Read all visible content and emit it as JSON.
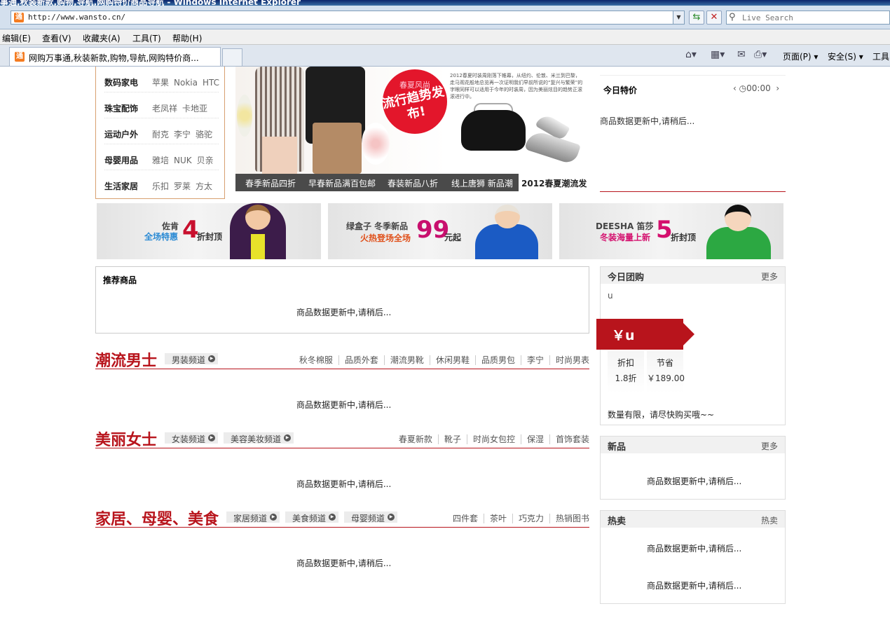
{
  "browser": {
    "window_title": "事通,秋装新款,购物,导航,网购特价商品导航 - Windows Internet Explorer",
    "url": "http://www.wansto.cn/",
    "favicon": "通",
    "search_placeholder": "Live Search",
    "menu": [
      "编辑(E)",
      "查看(V)",
      "收藏夹(A)",
      "工具(T)",
      "帮助(H)"
    ],
    "tab_title": "网购万事通,秋装新款,购物,导航,网购特价商...",
    "commands": {
      "page": "页面(P)",
      "safety": "安全(S)",
      "tools": "工具"
    }
  },
  "categories": [
    {
      "name": "数码家电",
      "links": [
        "苹果",
        "Nokia",
        "HTC"
      ]
    },
    {
      "name": "珠宝配饰",
      "links": [
        "老凤祥",
        "卡地亚"
      ]
    },
    {
      "name": "运动户外",
      "links": [
        "耐克",
        "李宁",
        "骆驼"
      ]
    },
    {
      "name": "母婴用品",
      "links": [
        "雅培",
        "NUK",
        "贝亲"
      ]
    },
    {
      "name": "生活家居",
      "links": [
        "乐扣",
        "罗莱",
        "方太"
      ]
    }
  ],
  "banner": {
    "circle_sub": "春夏风尚",
    "circle_main": "流行趋势发布!",
    "blurb": "2012春夏时装周刚落下帷幕，从纽约、伦敦、米兰到巴黎，走马观花般地总览再一次证明我们早前所说的“复兴与繁荣”的字眼同样可以适用于今年的时装周，因为美丽炫目的趋势正滚滚进行中。",
    "tabs": [
      "春季新品四折",
      "早春新品满百包邮",
      "春装新品八折",
      "线上唐狮 新品潮"
    ],
    "active_tab": "2012春夏潮流发"
  },
  "today_special": {
    "title": "今日特价",
    "timer": "00:00",
    "message": "商品数据更新中,请稍后..."
  },
  "promos": [
    {
      "brand": "佐肯",
      "sub": "全场特惠",
      "num": "4",
      "tail": "折封顶",
      "sub_color": "#2a8ad4",
      "num_color": "#c8102e"
    },
    {
      "brand": "绿盒子 冬季新品",
      "sub": "火热登场全场",
      "num": "99",
      "tail": "元起",
      "sub_color": "#e0501a",
      "num_color": "#c8106e"
    },
    {
      "brand": "DEESHA 笛莎",
      "sub": "冬装海量上新",
      "num": "5",
      "tail": "折封顶",
      "sub_color": "#d4106e",
      "num_color": "#d4106e"
    }
  ],
  "recommend": {
    "title": "推荐商品",
    "message": "商品数据更新中,请稍后..."
  },
  "sections": [
    {
      "title": "潮流男士",
      "channels": [
        "男装频道"
      ],
      "links": [
        "秋冬棉服",
        "品质外套",
        "潮流男靴",
        "休闲男鞋",
        "品质男包",
        "李宁",
        "时尚男表"
      ],
      "message": "商品数据更新中,请稍后..."
    },
    {
      "title": "美丽女士",
      "channels": [
        "女装频道",
        "美容美妆频道"
      ],
      "links": [
        "春夏新款",
        "靴子",
        "时尚女包控",
        "保湿",
        "首饰套装"
      ],
      "message": "商品数据更新中,请稍后..."
    },
    {
      "title": "家居、母婴、美食",
      "channels": [
        "家居频道",
        "美食频道",
        "母婴频道"
      ],
      "links": [
        "四件套",
        "茶叶",
        "巧克力",
        "热销图书"
      ],
      "message": "商品数据更新中,请稍后..."
    }
  ],
  "group_buy": {
    "title": "今日团购",
    "more": "更多",
    "name": "u",
    "price": "￥u",
    "discount_label": "折扣",
    "discount": "1.8折",
    "save_label": "节省",
    "save": "￥189.00",
    "note": "数量有限，请尽快购买哦~~"
  },
  "new_items": {
    "title": "新品",
    "more": "更多",
    "message": "商品数据更新中,请稍后..."
  },
  "hot_items": {
    "title": "热卖",
    "more": "热卖",
    "message1": "商品数据更新中,请稍后...",
    "message2": "商品数据更新中,请稍后..."
  },
  "colors": {
    "brand_red": "#b8141c",
    "ie_blue": "#0a246a"
  }
}
